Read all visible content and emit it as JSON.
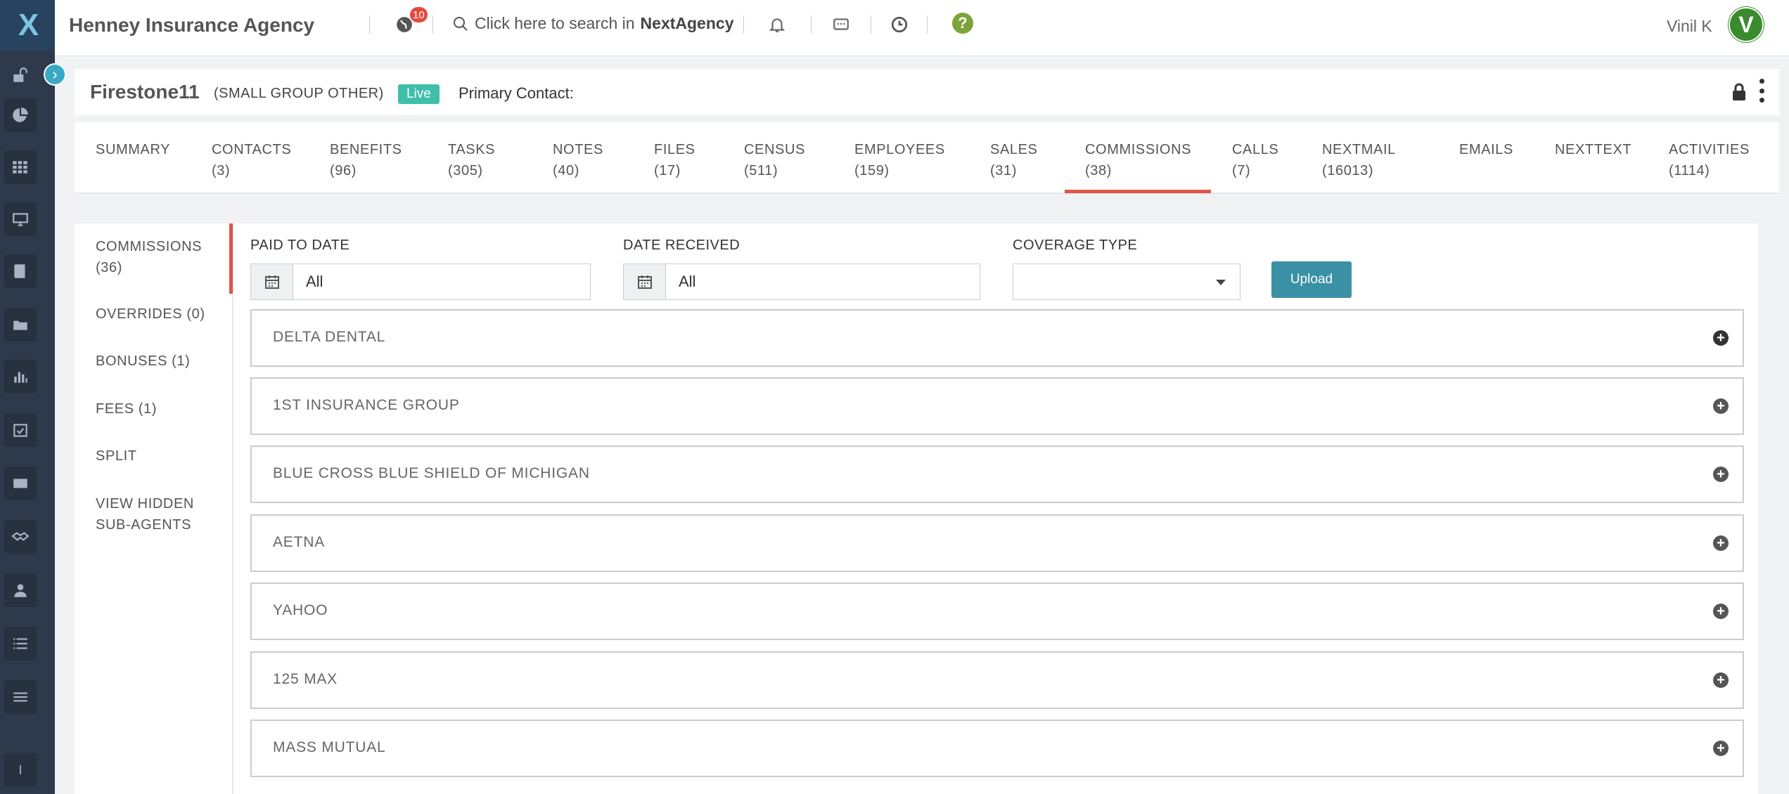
{
  "app": {
    "logo_text": "X",
    "agency_name": "Henney Insurance Agency",
    "notifications_count": "10",
    "search_prefix": "Click here to search in",
    "search_brand": "NextAgency",
    "help_label": "?",
    "user_name": "Vinil K",
    "user_initial": "V"
  },
  "record": {
    "name": "Firestone11",
    "type": "(SMALL GROUP OTHER)",
    "status": "Live",
    "primary_contact_label": "Primary Contact:"
  },
  "tabs": [
    {
      "label": "SUMMARY",
      "count": ""
    },
    {
      "label": "CONTACTS",
      "count": "(3)"
    },
    {
      "label": "BENEFITS",
      "count": "(96)"
    },
    {
      "label": "TASKS",
      "count": "(305)"
    },
    {
      "label": "NOTES",
      "count": "(40)"
    },
    {
      "label": "FILES",
      "count": "(17)"
    },
    {
      "label": "CENSUS",
      "count": "(511)"
    },
    {
      "label": "EMPLOYEES",
      "count": "(159)"
    },
    {
      "label": "SALES",
      "count": "(31)"
    },
    {
      "label": "COMMISSIONS",
      "count": "(38)"
    },
    {
      "label": "CALLS",
      "count": "(7)"
    },
    {
      "label": "NEXTMAIL",
      "count": "(16013)"
    },
    {
      "label": "EMAILS",
      "count": ""
    },
    {
      "label": "NEXTTEXT",
      "count": ""
    },
    {
      "label": "ACTIVITIES",
      "count": "(1114)"
    }
  ],
  "active_tab": "COMMISSIONS",
  "subnav": [
    {
      "label": "COMMISSIONS",
      "count": "(36)"
    },
    {
      "label": "OVERRIDES (0)",
      "count": ""
    },
    {
      "label": "BONUSES (1)",
      "count": ""
    },
    {
      "label": "FEES (1)",
      "count": ""
    },
    {
      "label": "SPLIT",
      "count": ""
    },
    {
      "label": "VIEW HIDDEN",
      "count": "SUB-AGENTS"
    }
  ],
  "filters": {
    "paid_to_date_label": "PAID TO DATE",
    "paid_to_date_value": "All",
    "date_received_label": "DATE RECEIVED",
    "date_received_value": "All",
    "coverage_type_label": "COVERAGE TYPE",
    "coverage_type_value": "",
    "upload_label": "Upload"
  },
  "carriers": [
    "DELTA DENTAL",
    "1ST INSURANCE GROUP",
    "BLUE CROSS BLUE SHIELD OF MICHIGAN",
    "AETNA",
    "YAHOO",
    "125 MAX",
    "MASS MUTUAL"
  ],
  "colors": {
    "rail": "#2e3a4b",
    "accent_red": "#e0534a",
    "live_badge": "#3fbfa9",
    "upload_button": "#3a91a5",
    "avatar": "#3a8b2e"
  }
}
